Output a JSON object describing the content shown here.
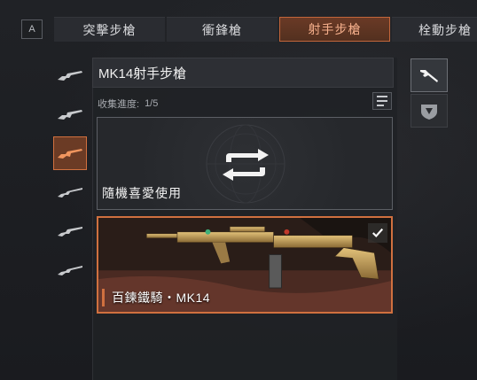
{
  "hotkey": "A",
  "tabs": [
    {
      "label": "突擊步槍",
      "active": false
    },
    {
      "label": "衝鋒槍",
      "active": false
    },
    {
      "label": "射手步槍",
      "active": true
    },
    {
      "label": "栓動步槍",
      "active": false
    }
  ],
  "weapon_list": [
    {
      "icon": "rifle-icon",
      "active": false
    },
    {
      "icon": "rifle-icon",
      "active": false
    },
    {
      "icon": "marksman-rifle-icon",
      "active": true
    },
    {
      "icon": "sniper-rifle-icon",
      "active": false
    },
    {
      "icon": "sniper-rifle-icon",
      "active": false
    },
    {
      "icon": "sniper-rifle-icon",
      "active": false
    }
  ],
  "panel": {
    "title": "MK14射手步槍",
    "progress_label": "收集進度:",
    "progress_value": "1/5",
    "random_card": {
      "label": "隨機喜愛使用",
      "icon": "shuffle-icon"
    },
    "skin_card": {
      "label": "百鍊鐵騎・MK14",
      "selected": true,
      "icon": "check-icon"
    }
  },
  "side_tabs": [
    {
      "icon": "weapon-icon",
      "active": true
    },
    {
      "icon": "emblem-icon",
      "active": false
    }
  ],
  "colors": {
    "accent": "#d0703f",
    "active_tab_bg": "#5e3422",
    "active_tab_text": "#f6b08c",
    "background": "#1c1e22"
  }
}
